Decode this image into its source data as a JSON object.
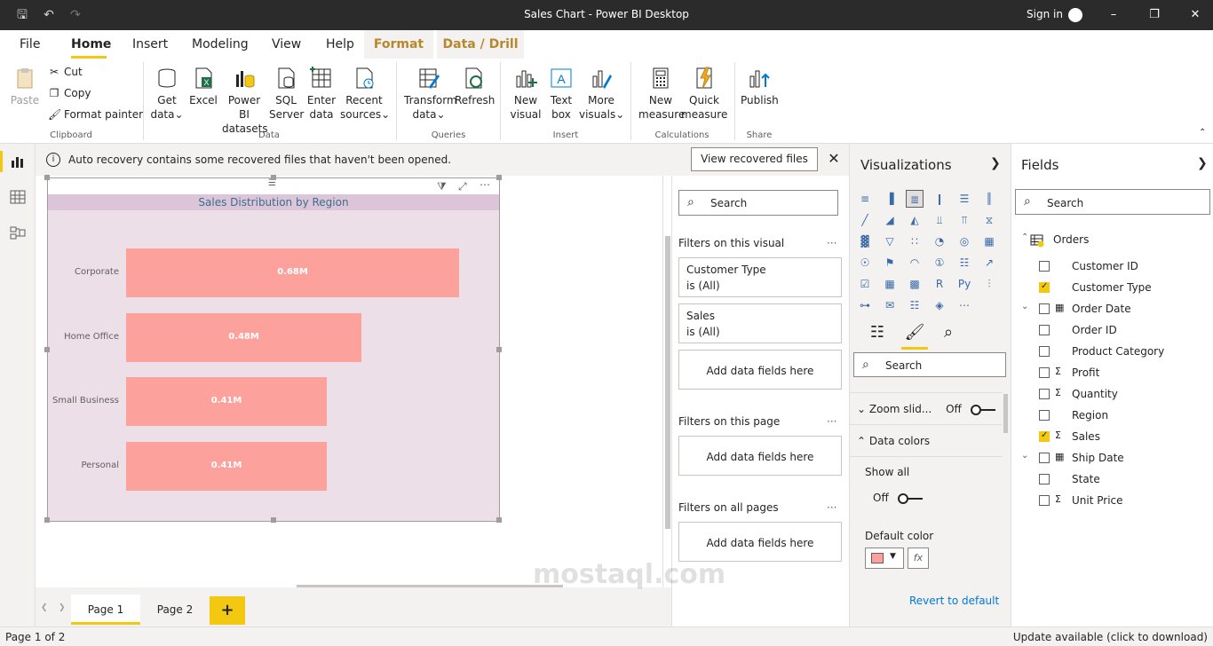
{
  "titlebar": {
    "title": "Sales Chart - Power BI Desktop",
    "sign_in": "Sign in"
  },
  "ribbon_tabs": [
    "File",
    "Home",
    "Insert",
    "Modeling",
    "View",
    "Help",
    "Format",
    "Data / Drill"
  ],
  "ribbon": {
    "clipboard": {
      "paste": "Paste",
      "cut": "Cut",
      "copy": "Copy",
      "format_painter": "Format painter",
      "label": "Clipboard"
    },
    "data": {
      "get_data_1": "Get",
      "get_data_2": "data",
      "excel": "Excel",
      "pbi_1": "Power BI",
      "pbi_2": "datasets",
      "sql_1": "SQL",
      "sql_2": "Server",
      "enter_1": "Enter",
      "enter_2": "data",
      "recent_1": "Recent",
      "recent_2": "sources",
      "label": "Data"
    },
    "queries": {
      "transform_1": "Transform",
      "transform_2": "data",
      "refresh": "Refresh",
      "label": "Queries"
    },
    "insert": {
      "new_visual_1": "New",
      "new_visual_2": "visual",
      "text_box_1": "Text",
      "text_box_2": "box",
      "more_1": "More",
      "more_2": "visuals",
      "label": "Insert"
    },
    "calculations": {
      "new_measure_1": "New",
      "new_measure_2": "measure",
      "quick_measure_1": "Quick",
      "quick_measure_2": "measure",
      "label": "Calculations"
    },
    "share": {
      "publish": "Publish",
      "label": "Share"
    }
  },
  "notification": {
    "text": "Auto recovery contains some recovered files that haven't been opened.",
    "button": "View recovered files"
  },
  "chart_data": {
    "type": "bar",
    "orientation": "horizontal",
    "title": "Sales Distribution by Region",
    "categories": [
      "Corporate",
      "Home Office",
      "Small Business",
      "Personal"
    ],
    "values": [
      0.68,
      0.48,
      0.41,
      0.41
    ],
    "data_labels": [
      "0.68M",
      "0.48M",
      "0.41M",
      "0.41M"
    ],
    "xlim": [
      0,
      0.68
    ],
    "grid": false,
    "colors": {
      "bar": "#fda19c",
      "background": "#eddfe8",
      "title_bar": "#dcc5d8",
      "title_text": "#3a6e8f"
    }
  },
  "pages": {
    "tabs": [
      "Page 1",
      "Page 2"
    ],
    "active": 0,
    "add": "+"
  },
  "status": {
    "left": "Page 1 of 2",
    "right": "Update available (click to download)"
  },
  "filters": {
    "search_placeholder": "Search",
    "on_visual": "Filters on this visual",
    "card1_title": "Customer Type",
    "card1_value": "is (All)",
    "card2_title": "Sales",
    "card2_value": "is (All)",
    "add_fields": "Add data fields here",
    "on_page": "Filters on this page",
    "on_all_pages": "Filters on all pages",
    "more": "···"
  },
  "visualizations": {
    "title": "Visualizations",
    "search_placeholder": "Search",
    "zoom_slider": "Zoom slid...",
    "zoom_state": "Off",
    "data_colors": "Data colors",
    "show_all": "Show all",
    "show_all_state": "Off",
    "default_color": "Default color",
    "fx": "fx",
    "revert": "Revert to default",
    "default_color_value": "#fda19c"
  },
  "fields": {
    "title": "Fields",
    "search_placeholder": "Search",
    "table": "Orders",
    "items": [
      {
        "name": "Customer ID",
        "checked": false,
        "type": "",
        "expandable": false
      },
      {
        "name": "Customer Type",
        "checked": true,
        "type": "",
        "expandable": false
      },
      {
        "name": "Order Date",
        "checked": false,
        "type": "calendar",
        "expandable": true
      },
      {
        "name": "Order ID",
        "checked": false,
        "type": "",
        "expandable": false
      },
      {
        "name": "Product Category",
        "checked": false,
        "type": "",
        "expandable": false
      },
      {
        "name": "Profit",
        "checked": false,
        "type": "sigma",
        "expandable": false
      },
      {
        "name": "Quantity",
        "checked": false,
        "type": "sigma",
        "expandable": false
      },
      {
        "name": "Region",
        "checked": false,
        "type": "",
        "expandable": false
      },
      {
        "name": "Sales",
        "checked": true,
        "type": "sigma",
        "expandable": false
      },
      {
        "name": "Ship Date",
        "checked": false,
        "type": "calendar",
        "expandable": true
      },
      {
        "name": "State",
        "checked": false,
        "type": "",
        "expandable": false
      },
      {
        "name": "Unit Price",
        "checked": false,
        "type": "sigma",
        "expandable": false
      }
    ]
  },
  "watermark": "mostaql.com"
}
